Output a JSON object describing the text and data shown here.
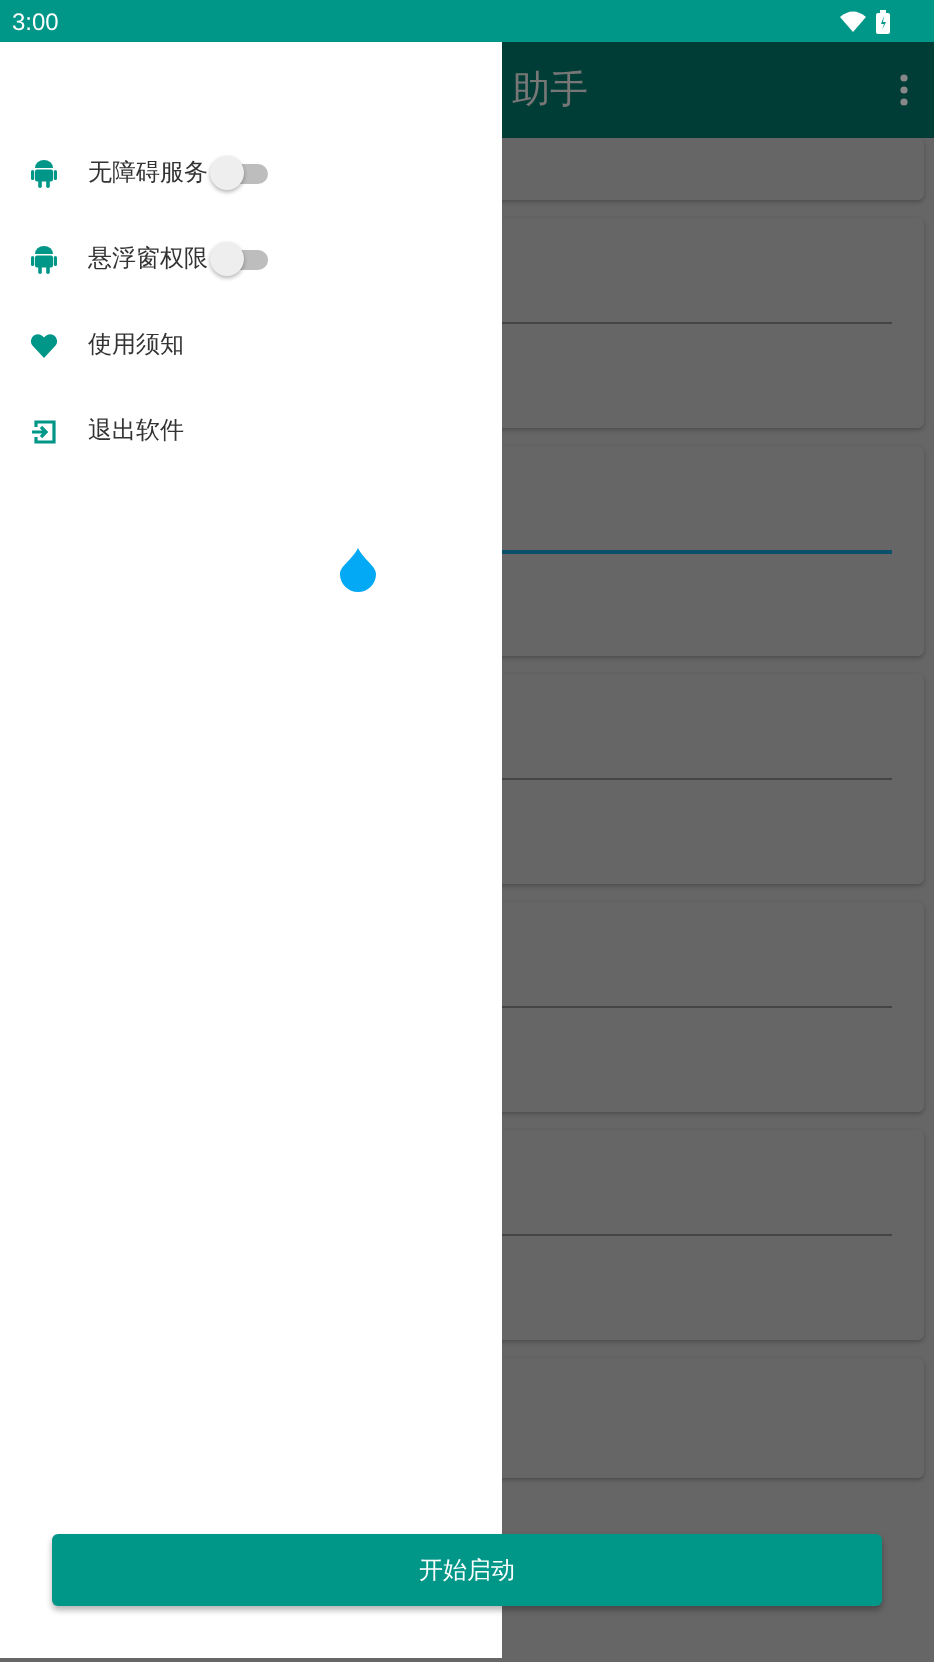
{
  "status_bar": {
    "time": "3:00"
  },
  "app_bar": {
    "title": "助手"
  },
  "cards": [
    {
      "kind": "plain"
    },
    {
      "kind": "field",
      "focused": false
    },
    {
      "kind": "field",
      "focused": true
    },
    {
      "kind": "field",
      "focused": false
    },
    {
      "kind": "field",
      "focused": false
    },
    {
      "kind": "field",
      "focused": false
    },
    {
      "kind": "plain"
    }
  ],
  "drawer": {
    "items": [
      {
        "kind": "switch",
        "label": "无障碍服务",
        "on": false
      },
      {
        "kind": "switch",
        "label": "悬浮窗权限",
        "on": false
      },
      {
        "kind": "link",
        "label": "使用须知"
      },
      {
        "kind": "link",
        "label": "退出软件"
      }
    ]
  },
  "start_button": {
    "label": "开始启动"
  }
}
